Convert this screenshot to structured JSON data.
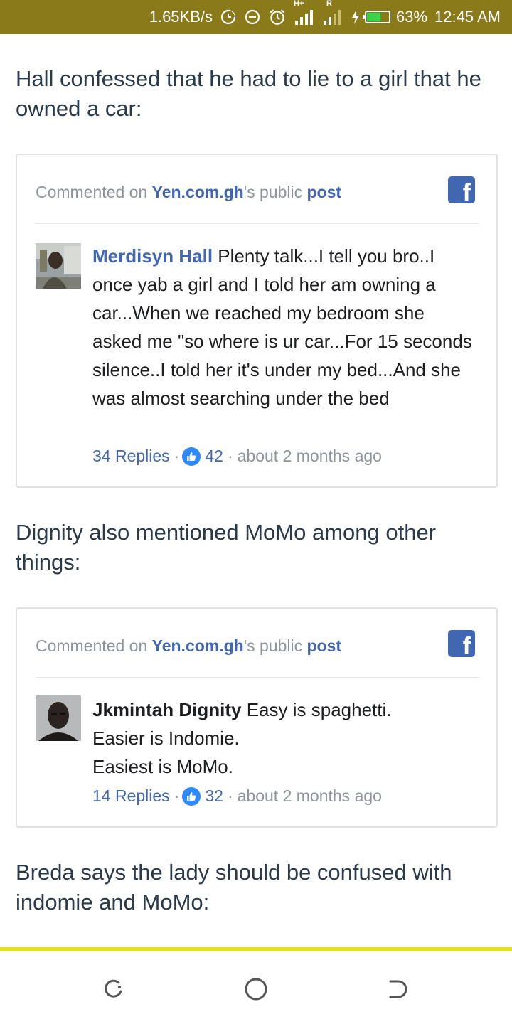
{
  "status_bar": {
    "speed": "1.65KB/s",
    "network": "H+",
    "roaming": "R",
    "battery_percent": "63%",
    "battery_level": 0.63,
    "time": "12:45 AM",
    "battery_color": "#3cd24a",
    "background": "#8a7a19"
  },
  "article": {
    "para1": "Hall confessed that he had to lie to a girl that he owned a car:",
    "para2": "Dignity also mentioned MoMo among other things:",
    "para3": "Breda says the lady should be confused with indomie and MoMo:"
  },
  "embeds": [
    {
      "head_prefix": "Commented on ",
      "page_link": "Yen.com.gh",
      "head_middle": "'s public ",
      "post_link": "post",
      "author": "Merdisyn Hall",
      "text": "Plenty talk...I tell you bro..I once yab a girl and I told her am owning a car...When we reached my bedroom she asked me \"so where is ur car...For 15 seconds silence..I told her it's under my bed...And she was almost searching under the bed",
      "replies": "34 Replies",
      "sep1": "·",
      "likes": "42",
      "sep2": "·",
      "time": "about 2 months ago"
    },
    {
      "head_prefix": "Commented on ",
      "page_link": "Yen.com.gh",
      "head_middle": "'s public ",
      "post_link": "post",
      "author": "Jkmintah Dignity",
      "text_line1": "Easy is spaghetti.",
      "text_line2": "Easier is Indomie.",
      "text_line3": "Easiest is MoMo.",
      "replies": "14 Replies",
      "sep1": "·",
      "likes": "32",
      "sep2": "·",
      "time": "about 2 months ago"
    }
  ],
  "icons": {
    "facebook": "f",
    "nav_back": "back-icon",
    "nav_home": "home-icon",
    "nav_recent": "recent-apps-icon"
  },
  "colors": {
    "link_blue": "#4267b2",
    "accent_yellow": "#e3dd27",
    "like_blue": "#2e89ff"
  }
}
